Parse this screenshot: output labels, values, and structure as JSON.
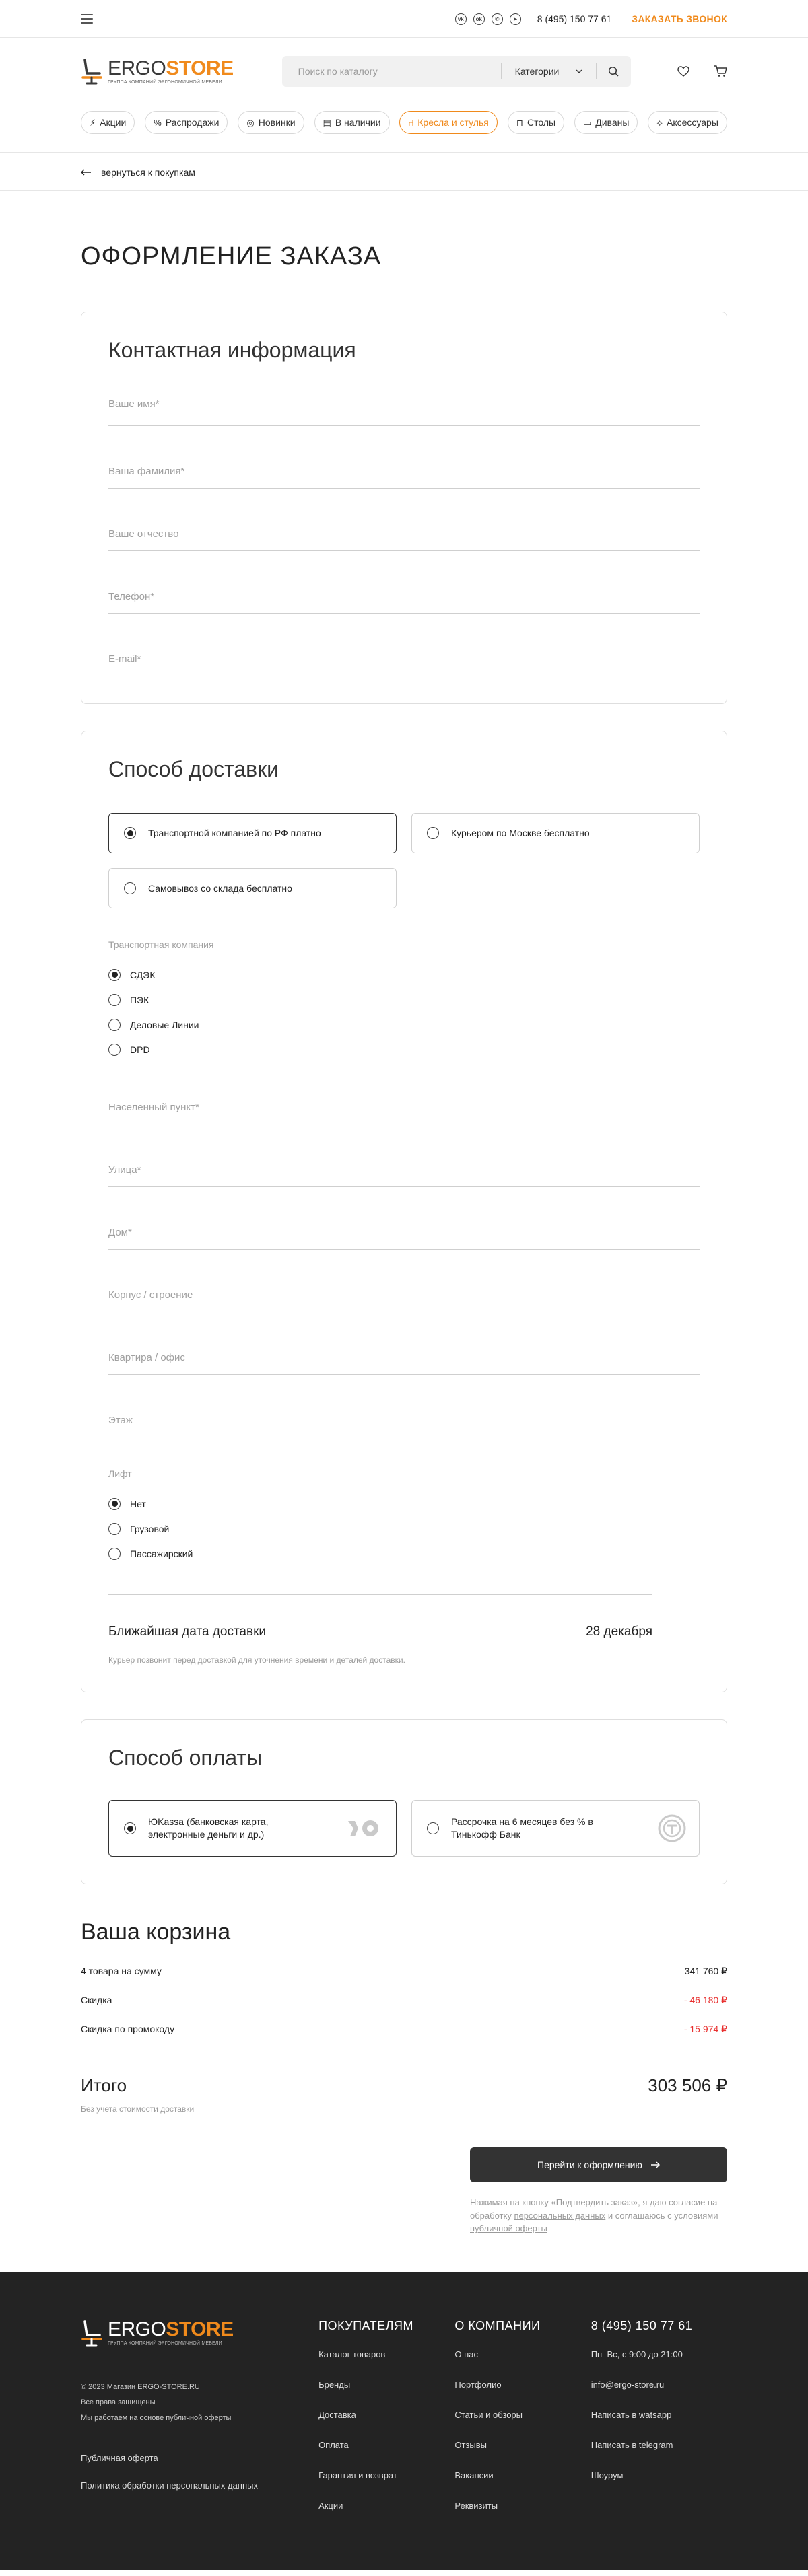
{
  "topbar": {
    "social": [
      "vk-icon",
      "odnoklassniki-icon",
      "whatsapp-icon",
      "telegram-icon"
    ],
    "phone": "8 (495) 150 77 61",
    "callback": "ЗАКАЗАТЬ ЗВОНОК"
  },
  "header": {
    "logo_part1": "ERGO",
    "logo_part2": "STORE",
    "logo_sub": "ГРУППА КОМПАНИЙ ЭРГОНОМИЧНОЙ МЕБЕЛИ",
    "search_placeholder": "Поиск по каталогу",
    "categories_label": "Категории"
  },
  "categories": [
    {
      "label": "Акции",
      "icon": "⚡"
    },
    {
      "label": "Распродажи",
      "icon": "%"
    },
    {
      "label": "Новинки",
      "icon": "◎"
    },
    {
      "label": "В наличии",
      "icon": "▤"
    },
    {
      "label": "Кресла и стулья",
      "icon": "⑁"
    },
    {
      "label": "Столы",
      "icon": "⊓"
    },
    {
      "label": "Диваны",
      "icon": "▭"
    },
    {
      "label": "Аксессуары",
      "icon": "⟡"
    }
  ],
  "back_link": "вернуться к покупкам",
  "page_title": "ОФОРМЛЕНИЕ ЗАКАЗА",
  "contact": {
    "title": "Контактная информация",
    "fields": [
      "Ваше имя*",
      "Ваша фамилия*",
      "Ваше отчество",
      "Телефон*",
      "E-mail*"
    ]
  },
  "delivery": {
    "title": "Способ доставки",
    "options": [
      {
        "label": "Транспортной компанией по РФ платно",
        "selected": true
      },
      {
        "label": "Курьером по Москве бесплатно",
        "selected": false
      },
      {
        "label": "Самовывоз со склада бесплатно",
        "selected": false
      }
    ],
    "company_label": "Транспортная компания",
    "companies": [
      {
        "label": "СДЭК",
        "selected": true
      },
      {
        "label": "ПЭК",
        "selected": false
      },
      {
        "label": "Деловые Линии",
        "selected": false
      },
      {
        "label": "DPD",
        "selected": false
      }
    ],
    "fields": [
      "Населенный пункт*",
      "Улица*",
      "Дом*",
      "Корпус / строение",
      "Квартира / офис",
      "Этаж"
    ],
    "lift_label": "Лифт",
    "lift": [
      {
        "label": "Нет",
        "selected": true
      },
      {
        "label": "Грузовой",
        "selected": false
      },
      {
        "label": "Пассажирский",
        "selected": false
      }
    ],
    "nearest_label": "Ближайшая дата доставки",
    "nearest_date": "28 декабря",
    "note": "Курьер позвонит перед доставкой для уточнения времени и деталей доставки."
  },
  "payment": {
    "title": "Способ оплаты",
    "options": [
      {
        "label": "ЮKassa (банковская карта, электронные деньги и др.)",
        "selected": true
      },
      {
        "label": "Рассрочка на 6 месяцев без % в Тинькофф Банк",
        "selected": false
      }
    ]
  },
  "cart": {
    "title": "Ваша корзина",
    "rows": [
      {
        "label": "4 товара на сумму",
        "value": "341 760 ₽",
        "negative": false
      },
      {
        "label": "Скидка",
        "value": "- 46 180 ₽",
        "negative": true
      },
      {
        "label": "Скидка по промокоду",
        "value": "- 15 974 ₽",
        "negative": true
      }
    ],
    "total_label": "Итого",
    "total_value": "303 506 ₽",
    "total_note": "Без учета стоимости доставки",
    "checkout": "Перейти к оформлению",
    "legal_1": "Нажимая на кнопку «Подтвердить заказ», я даю согласие на обработку ",
    "legal_link1": "персональных данных",
    "legal_2": " и соглашаюсь с условиями ",
    "legal_link2": "публичной оферты",
    "accent": "#f08a1c",
    "negative_color": "#e8302f"
  },
  "footer": {
    "copyright": "© 2023 Магазин ERGO-STORE.RU",
    "rights": "Все права защищены",
    "offer_note": "Мы работаем на основе публичной оферты",
    "link_offer": "Публичная оферта",
    "link_privacy": "Политика обработки персональных данных",
    "col1_title": "ПОКУПАТЕЛЯМ",
    "col1": [
      "Каталог товаров",
      "Бренды",
      "Доставка",
      "Оплата",
      "Гарантия и возврат",
      "Акции"
    ],
    "col2_title": "О КОМПАНИИ",
    "col2": [
      "О нас",
      "Портфолио",
      "Статьи и обзоры",
      "Отзывы",
      "Вакансии",
      "Реквизиты"
    ],
    "phone": "8 (495) 150 77 61",
    "hours": "Пн–Вс, с 9:00 до 21:00",
    "col3": [
      "info@ergo-store.ru",
      "Написать в watsapp",
      "Написать в telegram",
      "Шоурум"
    ]
  }
}
